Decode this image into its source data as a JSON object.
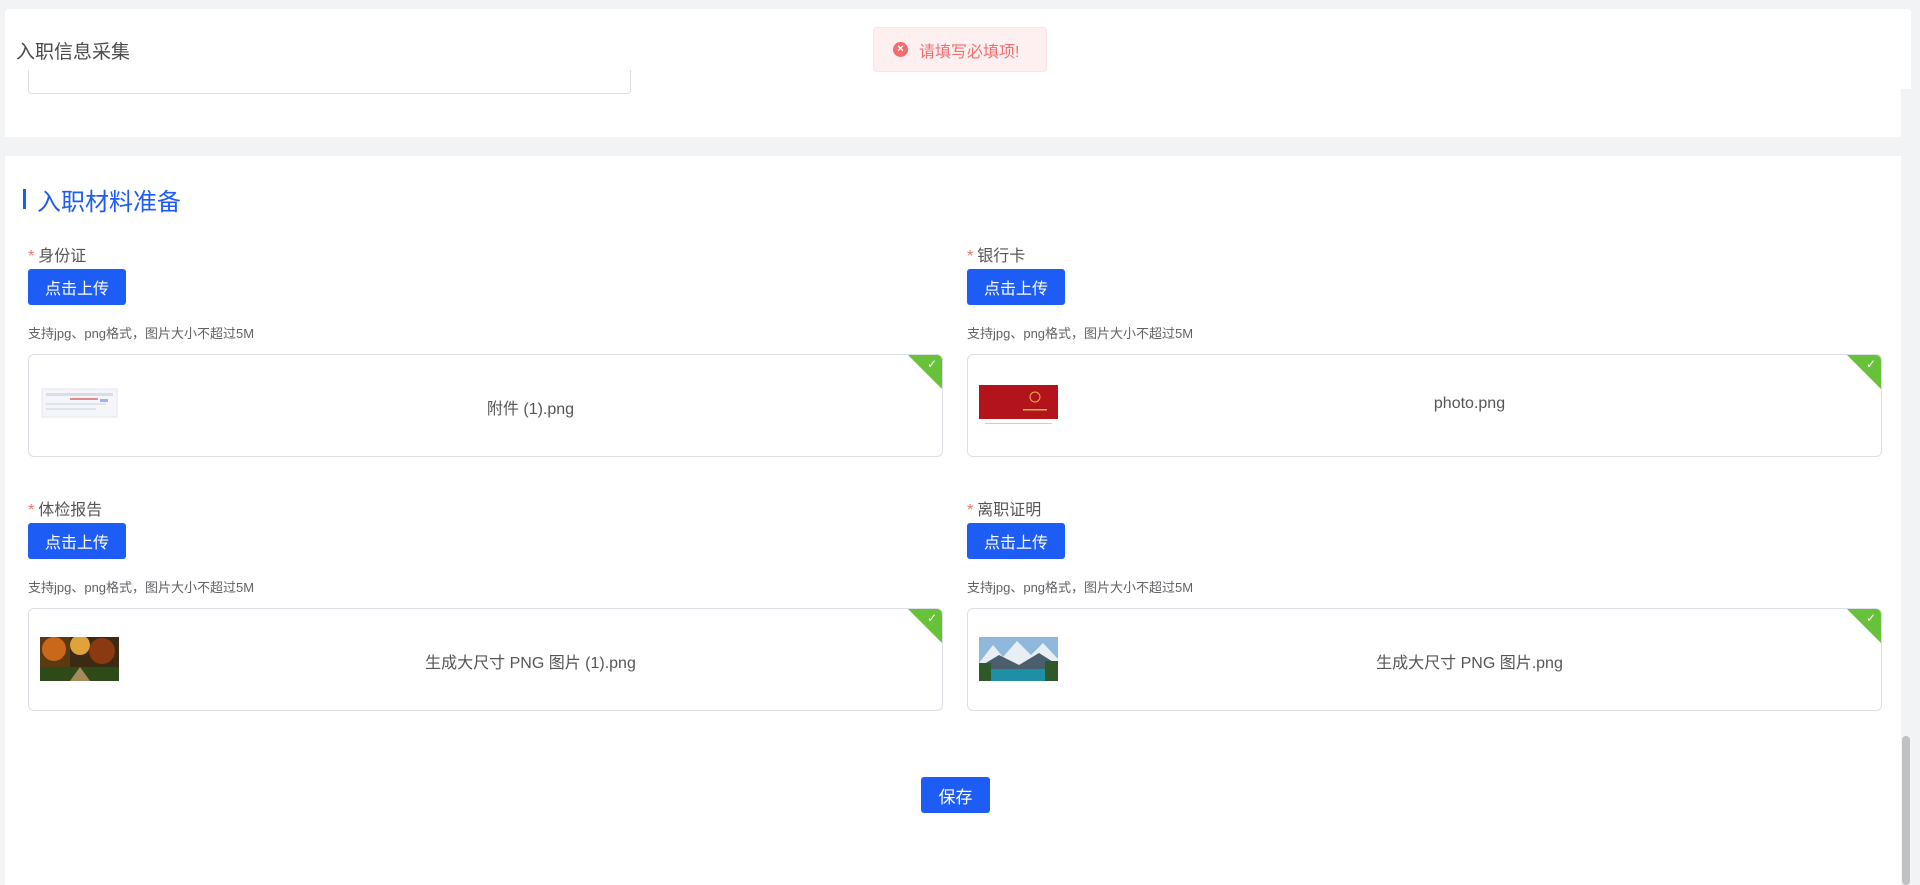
{
  "header": {
    "title": "入职信息采集"
  },
  "toast": {
    "icon": "error-circle-icon",
    "text": "请填写必填项!"
  },
  "section": {
    "title": "入职材料准备"
  },
  "required_mark": "*",
  "upload_label": "点击上传",
  "hint": "支持jpg、png格式，图片大小不超过5M",
  "fields": [
    {
      "label": "身份证",
      "file": "附件 (1).png",
      "status": "uploaded"
    },
    {
      "label": "银行卡",
      "file": "photo.png",
      "status": "uploaded"
    },
    {
      "label": "体检报告",
      "file": "生成大尺寸 PNG 图片 (1).png",
      "status": "uploaded"
    },
    {
      "label": "离职证明",
      "file": "生成大尺寸 PNG 图片.png",
      "status": "uploaded"
    }
  ],
  "save_label": "保存",
  "colors": {
    "primary": "#1d5cf5",
    "error": "#f56c6c",
    "success": "#67c23a"
  }
}
